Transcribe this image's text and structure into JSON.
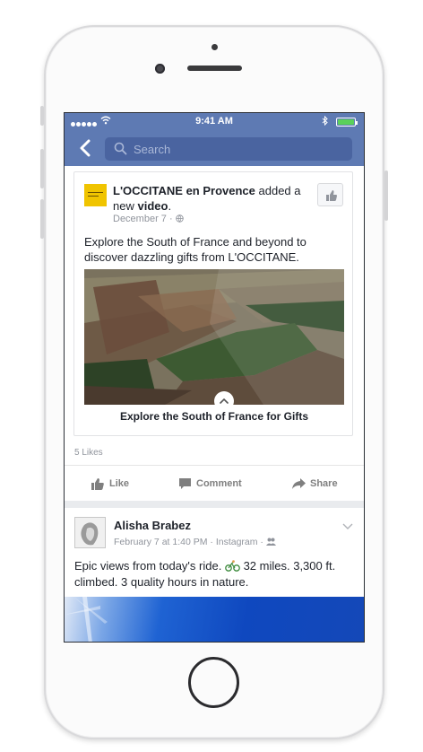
{
  "status_bar": {
    "time": "9:41 AM"
  },
  "nav": {
    "search_placeholder": "Search"
  },
  "post1": {
    "page_name": "L'OCCITANE en Provence",
    "action": "added a new",
    "action_object": "video",
    "date": "December 7",
    "body": "Explore the South of France and beyond to discover dazzling gifts from L'OCCITANE.",
    "link_caption": "Explore the South of France for Gifts",
    "likes": "5 Likes",
    "actions": {
      "like": "Like",
      "comment": "Comment",
      "share": "Share"
    }
  },
  "post2": {
    "author": "Alisha Brabez",
    "timestamp": "February 7 at 1:40 PM",
    "source": "Instagram",
    "body_before": "Epic views from today's ride.",
    "body_after": "32 miles. 3,300 ft. climbed. 3 quality hours in nature."
  },
  "colors": {
    "fb_blue": "#5e7ab3",
    "search_bg": "#4a64a0"
  }
}
